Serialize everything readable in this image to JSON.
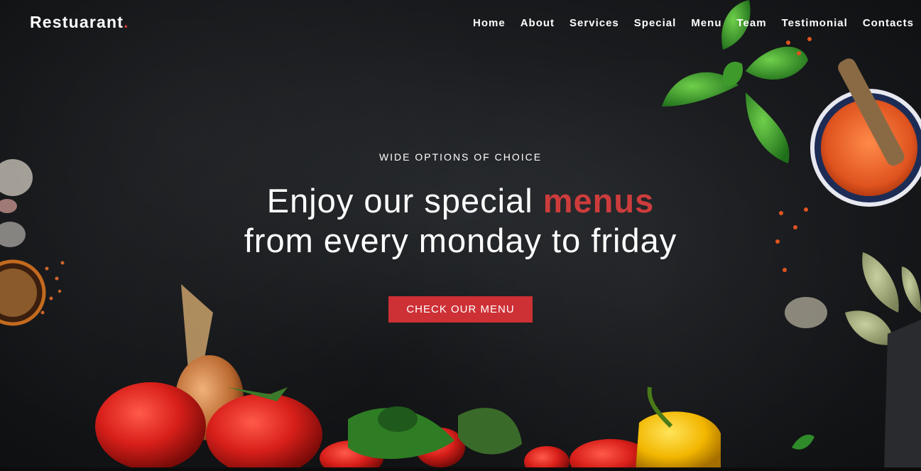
{
  "header": {
    "brand": "Restuarant",
    "brand_dot": ".",
    "nav": [
      "Home",
      "About",
      "Services",
      "Special",
      "Menu",
      "Team",
      "Testimonial",
      "Contacts"
    ]
  },
  "hero": {
    "eyebrow": "WIDE OPTIONS OF CHOICE",
    "headline_line1_prefix": "Enjoy our special ",
    "headline_accent": "menus",
    "headline_line2": "from every monday to friday",
    "cta": "CHECK OUR MENU"
  },
  "colors": {
    "accent": "#cd3c3c",
    "button": "#cd3035",
    "background": "#141517"
  }
}
